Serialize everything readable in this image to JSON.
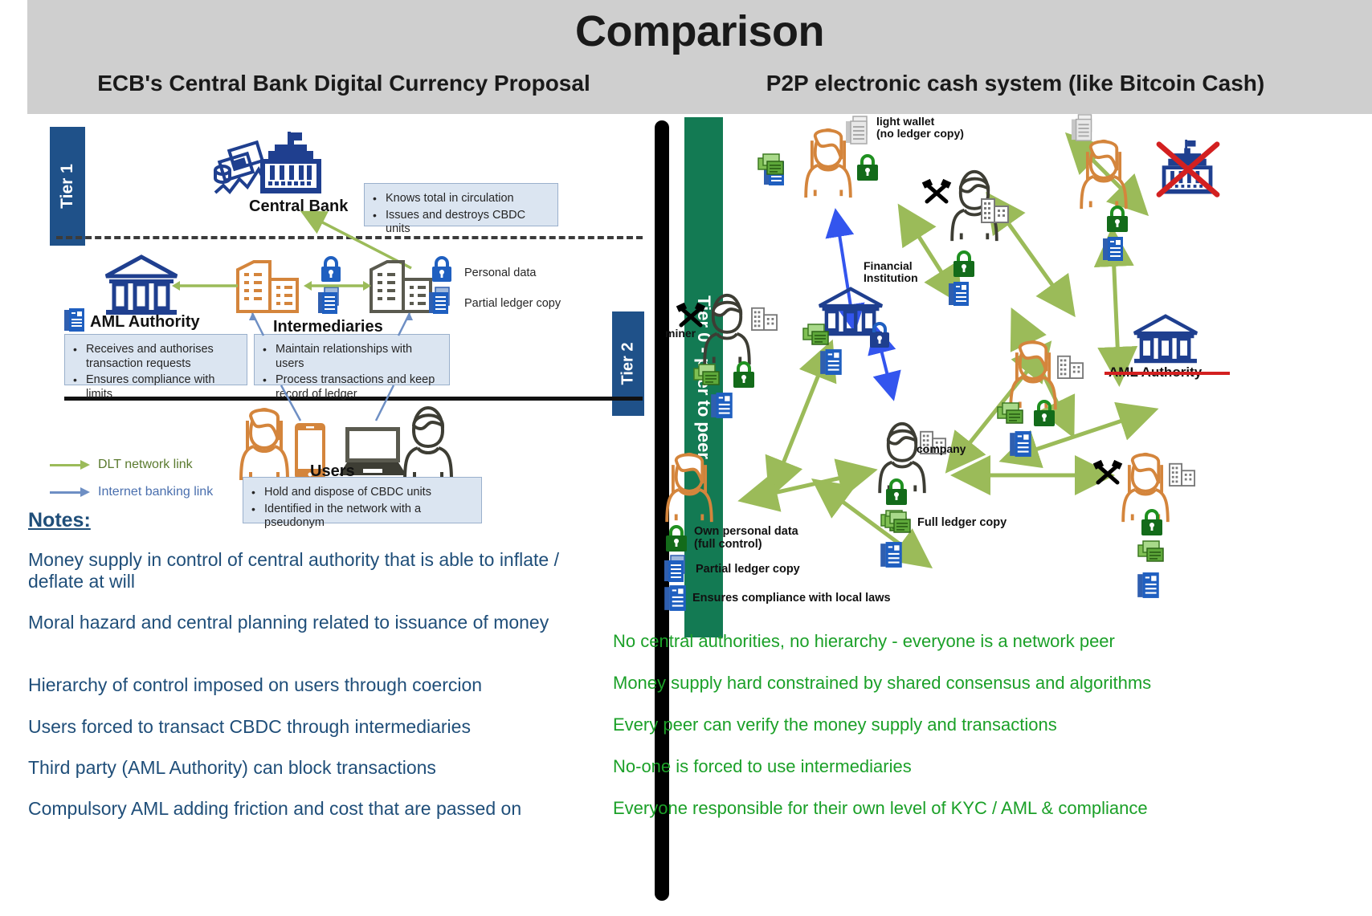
{
  "header": {
    "title": "Comparison",
    "subtitle_left": "ECB's Central Bank Digital Currency Proposal",
    "subtitle_right": "P2P electronic cash system (like Bitcoin Cash)"
  },
  "left": {
    "tier1_label": "Tier 1",
    "tier2_label": "Tier 2",
    "central_bank_label": "Central Bank",
    "central_bank_callout": [
      "Knows total in circulation",
      "Issues and destroys CBDC units"
    ],
    "aml_label": "AML Authority",
    "aml_callout": [
      "Receives and authorises transaction requests",
      "Ensures compliance with limits"
    ],
    "intermediaries_label": "Intermediaries",
    "intermediaries_callout": [
      "Maintain relationships with users",
      "Process transactions and keep record of ledger"
    ],
    "users_label": "Users",
    "users_callout": [
      "Hold and dispose of CBDC units",
      "Identified in the network with a pseudonym"
    ],
    "side_labels": {
      "personal_data": "Personal data",
      "partial_ledger": "Partial ledger copy"
    },
    "legend": [
      {
        "label": "DLT network link",
        "color": "#9bbb59"
      },
      {
        "label": "Internet banking link",
        "color": "#6e8fc4"
      }
    ],
    "notes_heading": "Notes:",
    "notes": [
      "Money supply in control of central authority that is able to inflate / deflate at will",
      "Moral hazard and central planning related to issuance of money",
      "Hierarchy of control imposed on users through coercion",
      "Users forced to transact CBDC through intermediaries",
      "Third party (AML Authority) can block transactions",
      "Compulsory AML adding friction and cost that are passed on"
    ]
  },
  "right": {
    "tier0_label": "Tier 0 - peer to peer",
    "node_labels": {
      "light_wallet": "light wallet\n(no ledger copy)",
      "financial_institution": "Financial\nInstitution",
      "miner": "miner",
      "company": "company",
      "aml_authority_crossed": "AML Authority"
    },
    "legend": [
      {
        "icon": "green-lock-icon",
        "label": "Own personal data\n   (full control)"
      },
      {
        "icon": "blue-documents-icon",
        "label": "Partial ledger copy"
      },
      {
        "icon": "blue-document-icon",
        "label": "Ensures compliance with local laws"
      },
      {
        "icon": "green-documents-icon",
        "label": "Full ledger copy"
      }
    ],
    "notes": [
      "No central authorities, no hierarchy - everyone is a network peer",
      "Money supply hard constrained by shared consensus and algorithms",
      "Every peer can verify the money supply and transactions",
      "No-one is forced to use intermediaries",
      "Everyone responsible for their own level of KYC / AML & compliance"
    ]
  },
  "colors": {
    "header_bg": "#cfcfcf",
    "tier_blue": "#1f5189",
    "tier_green": "#137a53",
    "note_blue": "#1f4e79",
    "note_green": "#1ba028",
    "dlt_green": "#9bbb59",
    "internet_blue": "#6e8fc4",
    "callout_bg": "#dbe5f1",
    "strike_red": "#d32020"
  }
}
